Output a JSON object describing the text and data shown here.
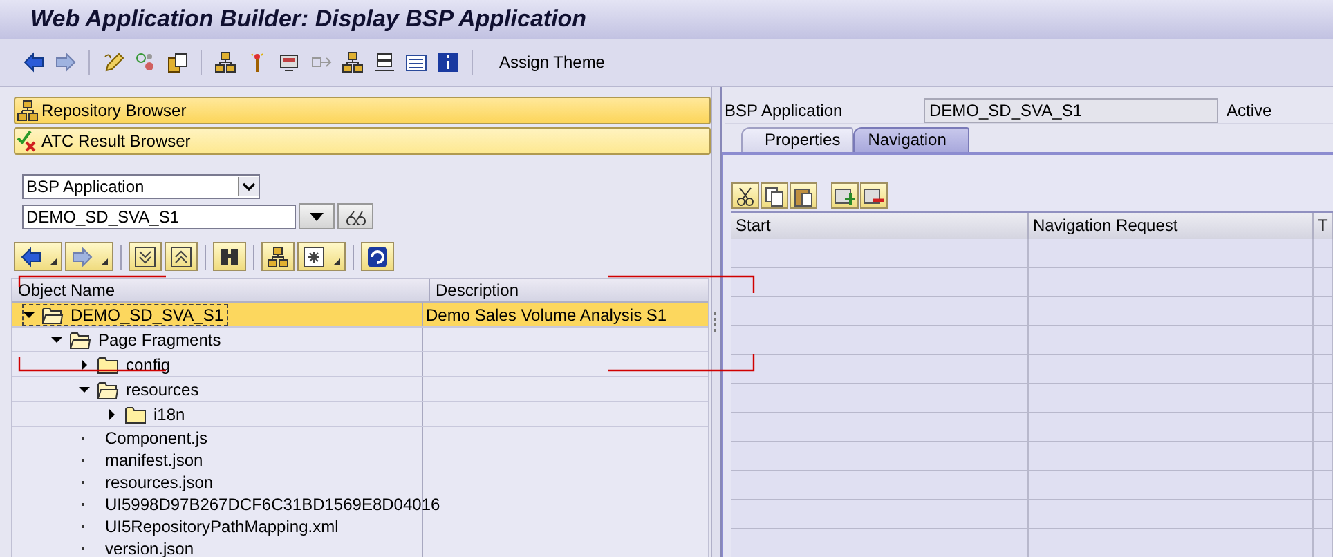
{
  "window": {
    "title": "Web Application Builder: Display BSP Application"
  },
  "toolbar": {
    "text_button": "Assign Theme"
  },
  "browser_bars": [
    {
      "label": "Repository Browser"
    },
    {
      "label": "ATC Result Browser"
    }
  ],
  "object_selector": {
    "type": "BSP Application",
    "name": "DEMO_SD_SVA_S1"
  },
  "tree": {
    "columns": [
      "Object Name",
      "Description"
    ],
    "rows": [
      {
        "kind": "folder",
        "name": "DEMO_SD_SVA_S1",
        "description": "Demo Sales Volume Analysis S1",
        "expanded": true,
        "selected": true,
        "children": [
          {
            "kind": "folder",
            "name": "Page Fragments",
            "expanded": true,
            "selected": false,
            "children": [
              {
                "kind": "folder",
                "name": "config",
                "expanded": false,
                "selected": false
              },
              {
                "kind": "folder",
                "name": "resources",
                "expanded": true,
                "selected": false,
                "children": [
                  {
                    "kind": "folder",
                    "name": "i18n",
                    "expanded": false,
                    "selected": false
                  }
                ]
              },
              {
                "kind": "file",
                "name": "Component.js",
                "selected": false
              },
              {
                "kind": "file",
                "name": "manifest.json",
                "selected": false
              },
              {
                "kind": "file",
                "name": "resources.json",
                "selected": false
              },
              {
                "kind": "file",
                "name": "UI5998D97B267DCF6C31BD1569E8D04016",
                "selected": false
              },
              {
                "kind": "file",
                "name": "UI5RepositoryPathMapping.xml",
                "selected": false
              },
              {
                "kind": "file",
                "name": "version.json",
                "selected": false
              }
            ]
          }
        ]
      }
    ]
  },
  "detail": {
    "label": "BSP Application",
    "value": "DEMO_SD_SVA_S1",
    "status": "Active",
    "tabs": [
      {
        "label": "Properties",
        "selected": false
      },
      {
        "label": "Navigation",
        "selected": true
      }
    ],
    "table": {
      "columns": [
        "Start",
        "Navigation Request",
        "T"
      ]
    }
  }
}
